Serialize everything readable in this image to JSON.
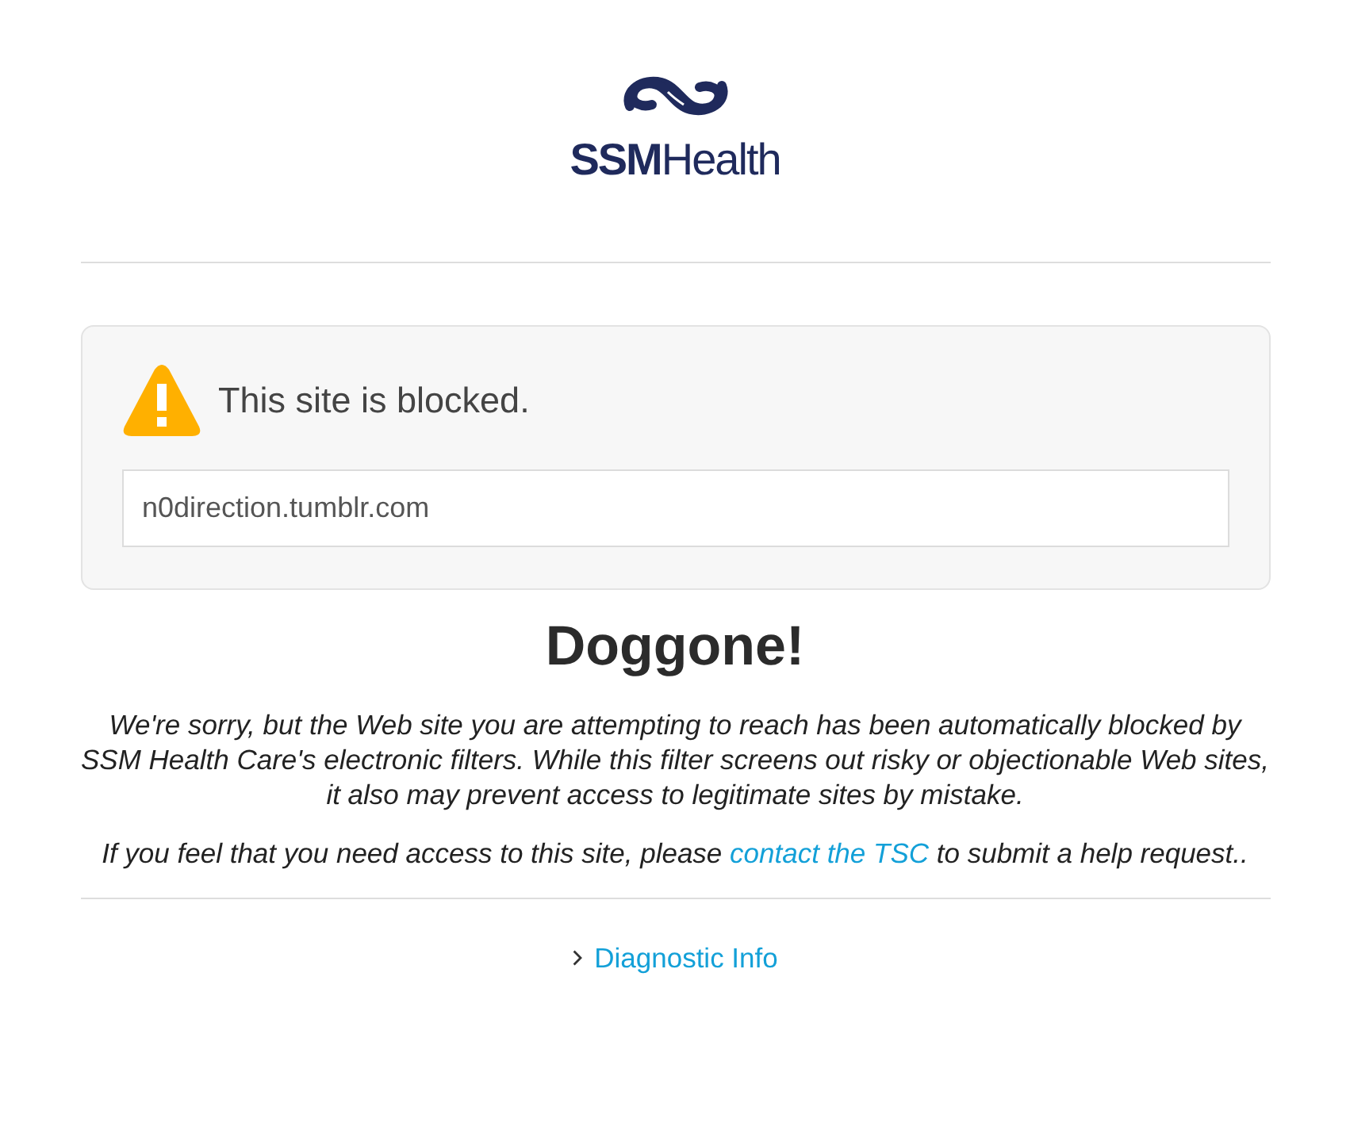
{
  "logo": {
    "wordmark": "**SSM**Health"
  },
  "blocked_notice": {
    "title": "This site is blocked.",
    "url": "n0direction.tumblr.com"
  },
  "heading": "Doggone!",
  "message": "We're sorry, but the Web site you are attempting to reach has been automatically blocked by SSM Health Care's electronic filters. While this filter screens out risky or objectionable Web sites, it also may prevent access to legitimate sites by mistake.",
  "help": {
    "before": "If you feel that you need access to this site, please ",
    "link": "contact the TSC",
    "after": " to submit a help request.."
  },
  "diagnostic": {
    "label": "Diagnostic Info",
    "expanded": false
  }
}
